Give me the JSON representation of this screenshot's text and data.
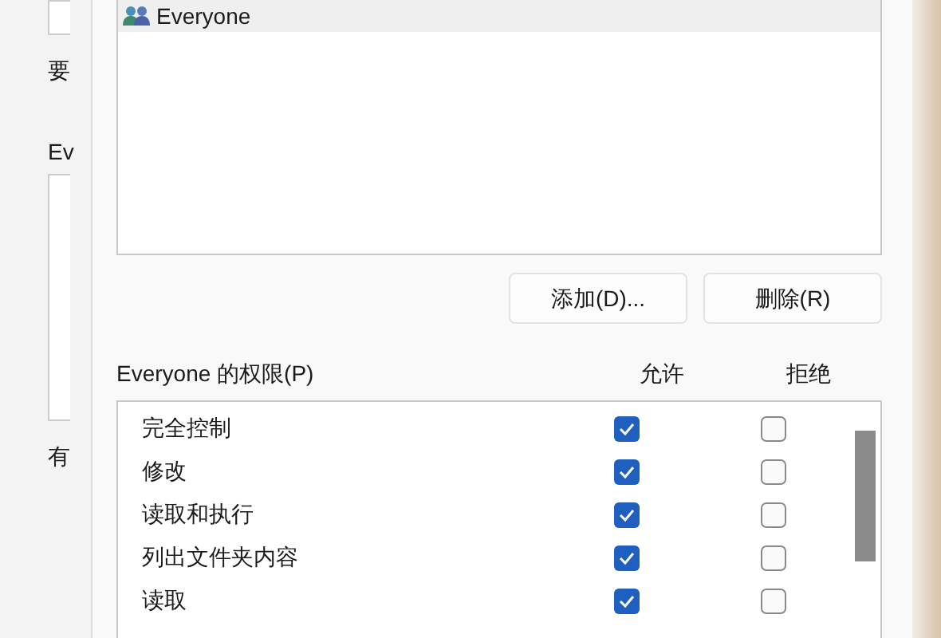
{
  "background_window": {
    "labels": [
      "要",
      "Ev",
      "有"
    ]
  },
  "dialog": {
    "users": [
      {
        "name": "Everyone",
        "selected": true
      }
    ],
    "buttons": [
      "添加(D)...",
      "删除(R)"
    ],
    "permissions_label": "Everyone 的权限(P)",
    "columns": [
      "允许",
      "拒绝"
    ],
    "permissions": [
      {
        "name": "完全控制",
        "allow": true,
        "deny": false
      },
      {
        "name": "修改",
        "allow": true,
        "deny": false
      },
      {
        "name": "读取和执行",
        "allow": true,
        "deny": false
      },
      {
        "name": "列出文件夹内容",
        "allow": true,
        "deny": false
      },
      {
        "name": "读取",
        "allow": true,
        "deny": false
      }
    ]
  }
}
